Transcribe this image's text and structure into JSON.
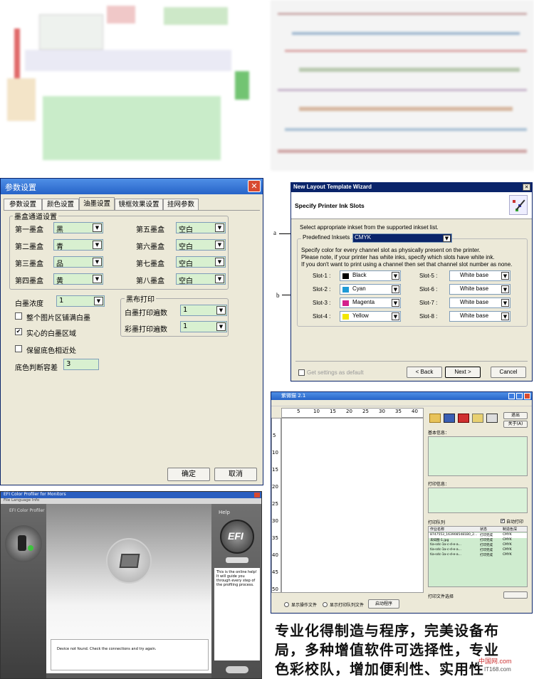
{
  "params_dialog": {
    "title": "参数设置",
    "tabs": [
      "参数设置",
      "颜色设置",
      "油墨设置",
      "镜框效果设置",
      "挂网参数"
    ],
    "active_tab": 2,
    "group_title": "墨盒通道设置",
    "slots_left": [
      {
        "label": "第一墨盒",
        "value": "黑"
      },
      {
        "label": "第二墨盒",
        "value": "青"
      },
      {
        "label": "第三墨盒",
        "value": "品"
      },
      {
        "label": "第四墨盒",
        "value": "黄"
      }
    ],
    "slots_right": [
      {
        "label": "第五墨盒",
        "value": "空白"
      },
      {
        "label": "第六墨盒",
        "value": "空白"
      },
      {
        "label": "第七墨盒",
        "value": "空白"
      },
      {
        "label": "第八墨盒",
        "value": "空白"
      }
    ],
    "white_density_label": "白墨浓度",
    "white_density_value": "1",
    "cb_fill_all": "整个图片区铺满白墨",
    "cb_solid_white": "实心的白墨区域",
    "cb_keep_bg": "保留底色相近处",
    "bg_tolerance_label": "底色判断容差",
    "bg_tolerance_value": "3",
    "black_group_title": "黑布打印",
    "white_passes_label": "白墨打印遍数",
    "white_passes_value": "1",
    "color_passes_label": "彩墨打印遍数",
    "color_passes_value": "1",
    "ok": "确定",
    "cancel": "取消"
  },
  "wizard": {
    "title": "New Layout Template Wizard",
    "heading": "Specify Printer Ink Slots",
    "instruction": "Select appropriate inkset from the supported inkset list.",
    "predefined_label": "Predefined Inksets",
    "predefined_value": "CMYK",
    "note1": "Specify color for every channel slot as physically present on the printer.",
    "note2": "Please note, if your printer has white inks, specify which slots have white ink.",
    "note3": "If you don't want to print using a channel then set that channel slot number as none.",
    "slots_left": [
      {
        "label": "Slot-1 :",
        "value": "Black",
        "color": "#000000"
      },
      {
        "label": "Slot-2 :",
        "value": "Cyan",
        "color": "#1e9ad6"
      },
      {
        "label": "Slot-3 :",
        "value": "Magenta",
        "color": "#d4208c"
      },
      {
        "label": "Slot-4 :",
        "value": "Yellow",
        "color": "#f2e600"
      }
    ],
    "slots_right": [
      {
        "label": "Slot-5 :",
        "value": "White base"
      },
      {
        "label": "Slot-6 :",
        "value": "White base"
      },
      {
        "label": "Slot-7 :",
        "value": "White base"
      },
      {
        "label": "Slot-8 :",
        "value": "White base"
      }
    ],
    "get_default": "Get settings as default",
    "back": "< Back",
    "next": "Next >",
    "cancel": "Cancel",
    "callout_a": "a",
    "callout_b": "b"
  },
  "efi": {
    "title": "EFI Color Profiler for Monitors",
    "menu": "File  Language  Info",
    "app_label": "EFI Color Profiler",
    "help_label": "Help",
    "logo": "EFI",
    "help_text": "This is the online help! It will guide you through every step of the profiling process.",
    "status": "Device not found. Check the connections and try again."
  },
  "ripapp": {
    "title": "紫微猫 2.1",
    "ruler": [
      "5",
      "10",
      "15",
      "20",
      "25",
      "30",
      "35",
      "40"
    ],
    "vruler": [
      "5",
      "10",
      "15",
      "20",
      "25",
      "30",
      "35",
      "40",
      "45",
      "50"
    ],
    "exit": "退出",
    "about": "关于(A)",
    "section1": "基本信息：",
    "section2": "打印信息：",
    "queue_label": "打印队列",
    "auto_print": "自动打印",
    "cols": [
      "作业名称",
      "状态",
      "制造色深"
    ],
    "rows": [
      [
        "8747553_1639085481B0_2...",
        "打印完成",
        "CMYK"
      ],
      [
        "未知图-1.jpg",
        "打印完成",
        "CMYK"
      ],
      [
        "tia-sdc-1a-c-d-e-a...",
        "打印完成",
        "CMYK"
      ],
      [
        "tia-sdc-1a-c-d-e-a...",
        "打印完成",
        "CMYK"
      ],
      [
        "tia-sdc-1a-c-d-e-a...",
        "打印完成",
        "CMYK"
      ]
    ],
    "bottom_label": "打印文件选择",
    "radio1": "显示操作文件",
    "radio2": "显示打印队列文件",
    "start_btn": "启动程序"
  },
  "caption": {
    "line1": "专业化得制造与程序，完美设备布",
    "line2": "局，多种增值软件可选择性，专业",
    "line3": "色彩校队，增加便利性、实用性",
    "watermark": "中国网.com",
    "watermark2": "IT168.com"
  }
}
